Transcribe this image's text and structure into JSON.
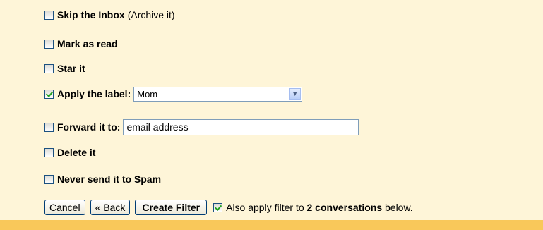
{
  "filter_actions": {
    "skip_inbox": {
      "label": "Skip the Inbox",
      "note": "(Archive it)",
      "checked": false
    },
    "mark_read": {
      "label": "Mark as read",
      "checked": false
    },
    "star": {
      "label": "Star it",
      "checked": false
    },
    "apply_label": {
      "label": "Apply the label:",
      "checked": true,
      "selected": "Mom"
    },
    "forward": {
      "label": "Forward it to:",
      "checked": false,
      "placeholder": "email address"
    },
    "delete": {
      "label": "Delete it",
      "checked": false
    },
    "never_spam": {
      "label": "Never send it to Spam",
      "checked": false
    }
  },
  "buttons": {
    "cancel": "Cancel",
    "back": "« Back",
    "create": "Create Filter"
  },
  "also_apply": {
    "checked": true,
    "prefix": "Also apply filter to ",
    "count_text": "2 conversations",
    "suffix": " below."
  },
  "colors": {
    "panel_bg": "#fef5d8",
    "bottom_bar": "#f9c85a",
    "check_green": "#21a121"
  }
}
